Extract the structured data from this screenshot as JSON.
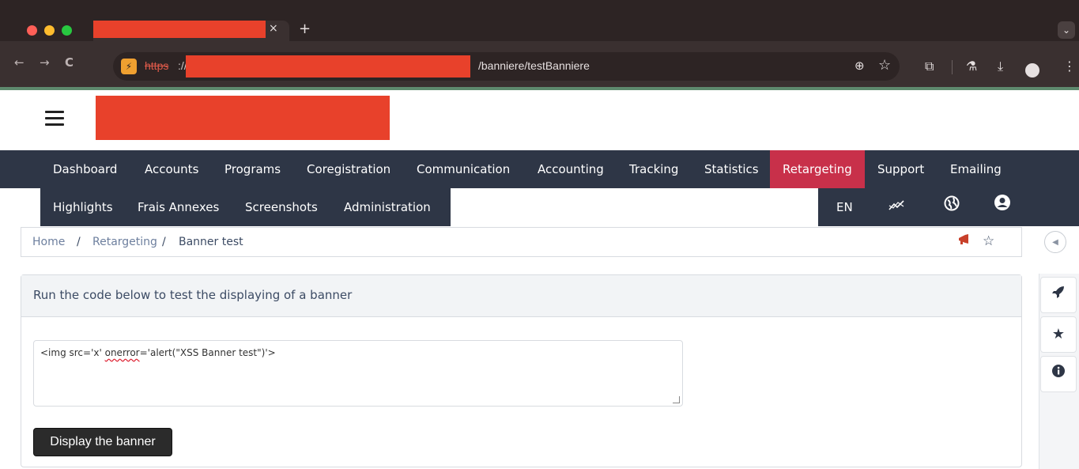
{
  "browser": {
    "new_tab_label": "+",
    "close_tab_label": "×",
    "tab_menu_label": "⌄",
    "url_scheme": "https",
    "url_sep": "://",
    "url_path": "/banniere/testBanniere",
    "nav": {
      "back": "←",
      "forward": "→",
      "reload": "C"
    },
    "site_info_icon": "⚡",
    "tools": {
      "zoom": "⊕",
      "bookmark": "☆",
      "extensions": "⧉",
      "lab": "⚗",
      "download": "⤓",
      "profile": "●",
      "menu": "⋮"
    }
  },
  "nav": {
    "row1": [
      "Dashboard",
      "Accounts",
      "Programs",
      "Coregistration",
      "Communication",
      "Accounting",
      "Tracking",
      "Statistics",
      "Retargeting",
      "Support",
      "Emailing"
    ],
    "row2": [
      "Highlights",
      "Frais Annexes",
      "Screenshots",
      "Administration"
    ],
    "lang": "EN",
    "active": "Retargeting",
    "icons": [
      "chart-line-icon",
      "globe-icon",
      "user-circle-icon"
    ]
  },
  "breadcrumb": {
    "home": "Home",
    "sep": "/",
    "section": "Retargeting",
    "current": "Banner test"
  },
  "card": {
    "title": "Run the code below to test the displaying of a banner",
    "code_before": "<img src='x' ",
    "code_squiggle": "onerror",
    "code_after": "='alert(\"XSS Banner test\")'>",
    "button": "Display the banner"
  },
  "side": {
    "toggle": "◀",
    "buttons": [
      "rocket-icon",
      "star-icon",
      "info-icon"
    ]
  },
  "colors": {
    "nav_bg": "#2e3646",
    "active": "#c8304a",
    "redaction": "#e8412b"
  }
}
